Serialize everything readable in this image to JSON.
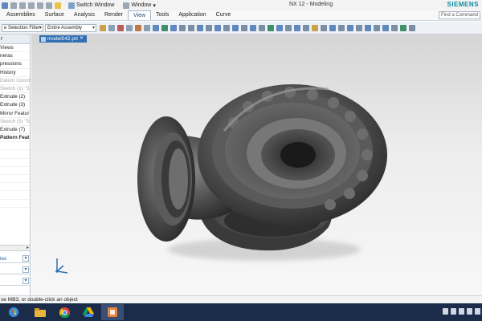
{
  "window": {
    "title": "NX 12 - Modeling",
    "brand": "SIEMENS",
    "switch_window": "Switch Window",
    "window_menu": "Window"
  },
  "menu": {
    "tabs": [
      "Assemblies",
      "Surface",
      "Analysis",
      "Render",
      "View",
      "Tools",
      "Application",
      "Curve"
    ],
    "active": "View"
  },
  "search": {
    "placeholder": "Find a Command"
  },
  "toolbar": {
    "selection_filter": "e Selection Filter",
    "assembly_scope": "Entire Assembly"
  },
  "navigator": {
    "header": "r",
    "items": [
      {
        "label": "Views",
        "style": "normal"
      },
      {
        "label": "neras",
        "style": "normal"
      },
      {
        "label": "pressions",
        "style": "normal"
      },
      {
        "label": "History",
        "style": "normal"
      },
      {
        "label": "Datum Coord",
        "style": "dim"
      },
      {
        "label": "Sketch (1) \"SK",
        "style": "dim"
      },
      {
        "label": "Extrude (2)",
        "style": "normal"
      },
      {
        "label": "Extrude (3)",
        "style": "normal"
      },
      {
        "label": "Mirror Featur",
        "style": "normal"
      },
      {
        "label": "Sketch (5) \"SK",
        "style": "dim"
      },
      {
        "label": "Extrude (7)",
        "style": "normal"
      },
      {
        "label": "Pattern Feat",
        "style": "bold"
      }
    ],
    "panels": [
      "ies",
      "",
      ""
    ]
  },
  "document_tab": {
    "label": "model042.prt"
  },
  "status": {
    "text": "se MB3, or double-click an object"
  },
  "taskbar": {
    "apps": [
      "start-icon",
      "file-explorer-icon",
      "chrome-icon",
      "google-drive-icon",
      "nx-app-icon"
    ]
  },
  "colors": {
    "accent": "#2f6fb2",
    "brand": "#0a8aa3",
    "taskbar": "#1b2b4a"
  }
}
